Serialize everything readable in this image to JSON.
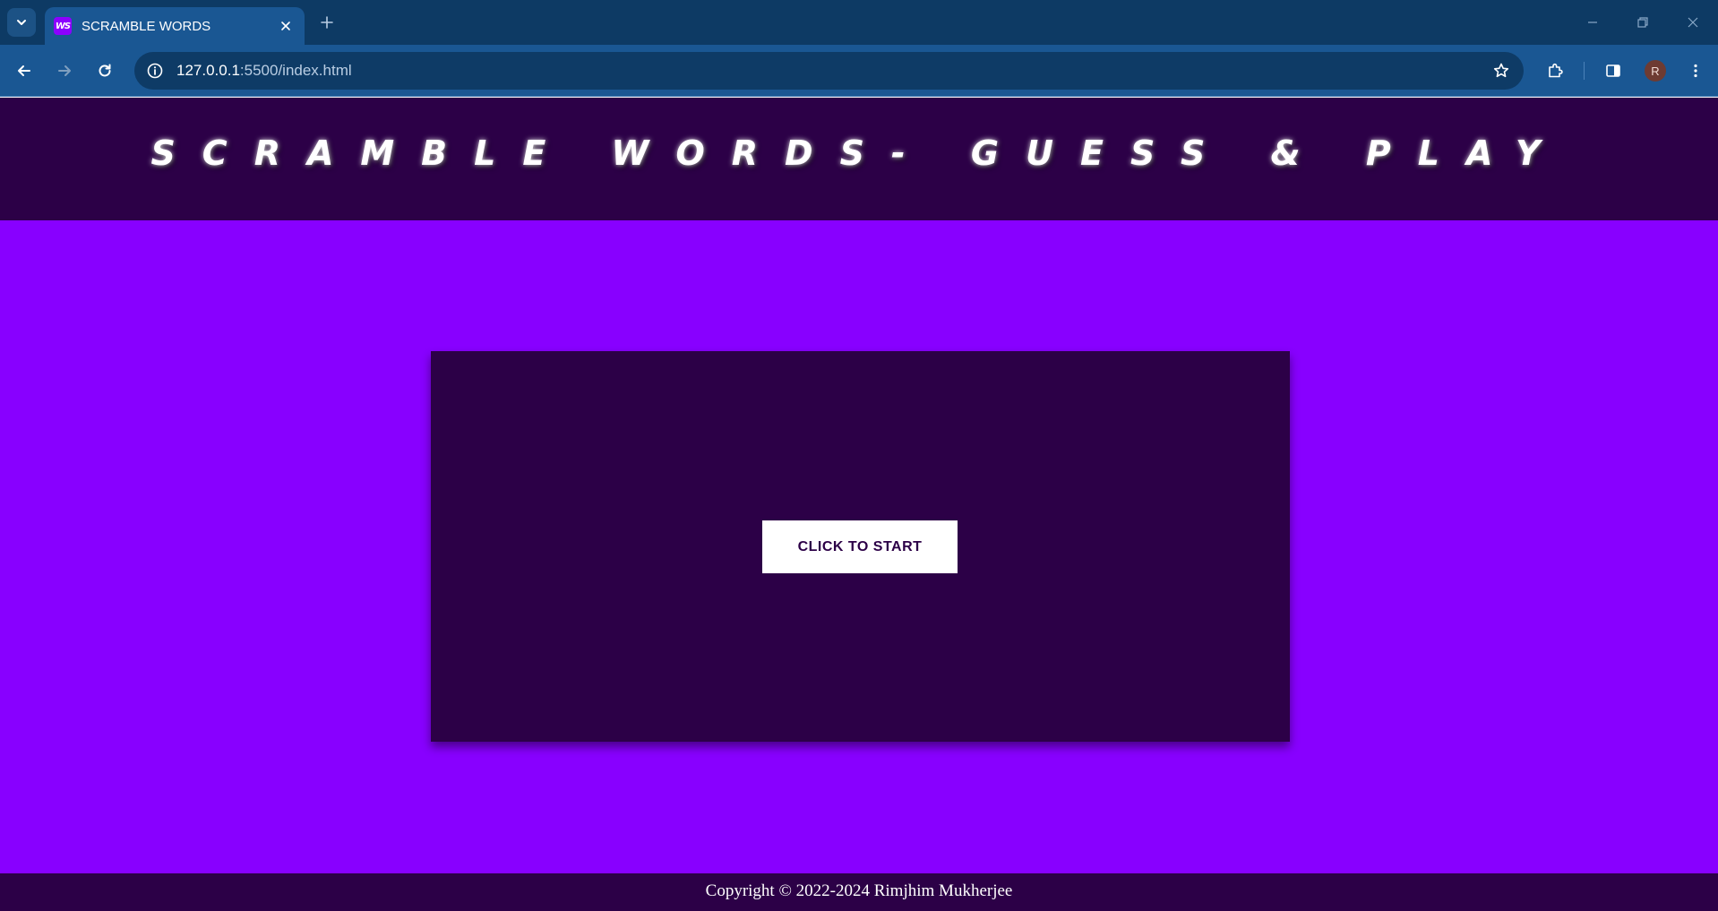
{
  "browser": {
    "tab": {
      "favicon_text": "WS",
      "title": "SCRAMBLE WORDS"
    },
    "url": {
      "host": "127.0.0.1",
      "rest": ":5500/index.html"
    },
    "profile_initial": "R",
    "icons": {
      "tab_list": "chevron-down-icon",
      "tab_close": "close-icon",
      "new_tab": "plus-icon",
      "minimize": "minimize-icon",
      "restore": "restore-icon",
      "close_window": "close-icon",
      "back": "arrow-left-icon",
      "forward": "arrow-right-icon",
      "reload": "reload-icon",
      "site_info": "info-icon",
      "bookmark": "star-icon",
      "extensions": "puzzle-icon",
      "side_panel": "side-panel-icon",
      "menu": "kebab-menu-icon"
    }
  },
  "page": {
    "header": {
      "title": "SCRAMBLE WORDS- GUESS & PLAY"
    },
    "game": {
      "start_label": "CLICK TO START"
    },
    "footer": {
      "copyright": "Copyright © 2022-2024 Rimjhim Mukherjee"
    }
  },
  "colors": {
    "page_background": "#8800ff",
    "panel": "#2c0047",
    "browser_frame": "#0d3a64",
    "browser_toolbar": "#1a5793",
    "button_background": "#ffffff",
    "button_text": "#2c0047"
  }
}
